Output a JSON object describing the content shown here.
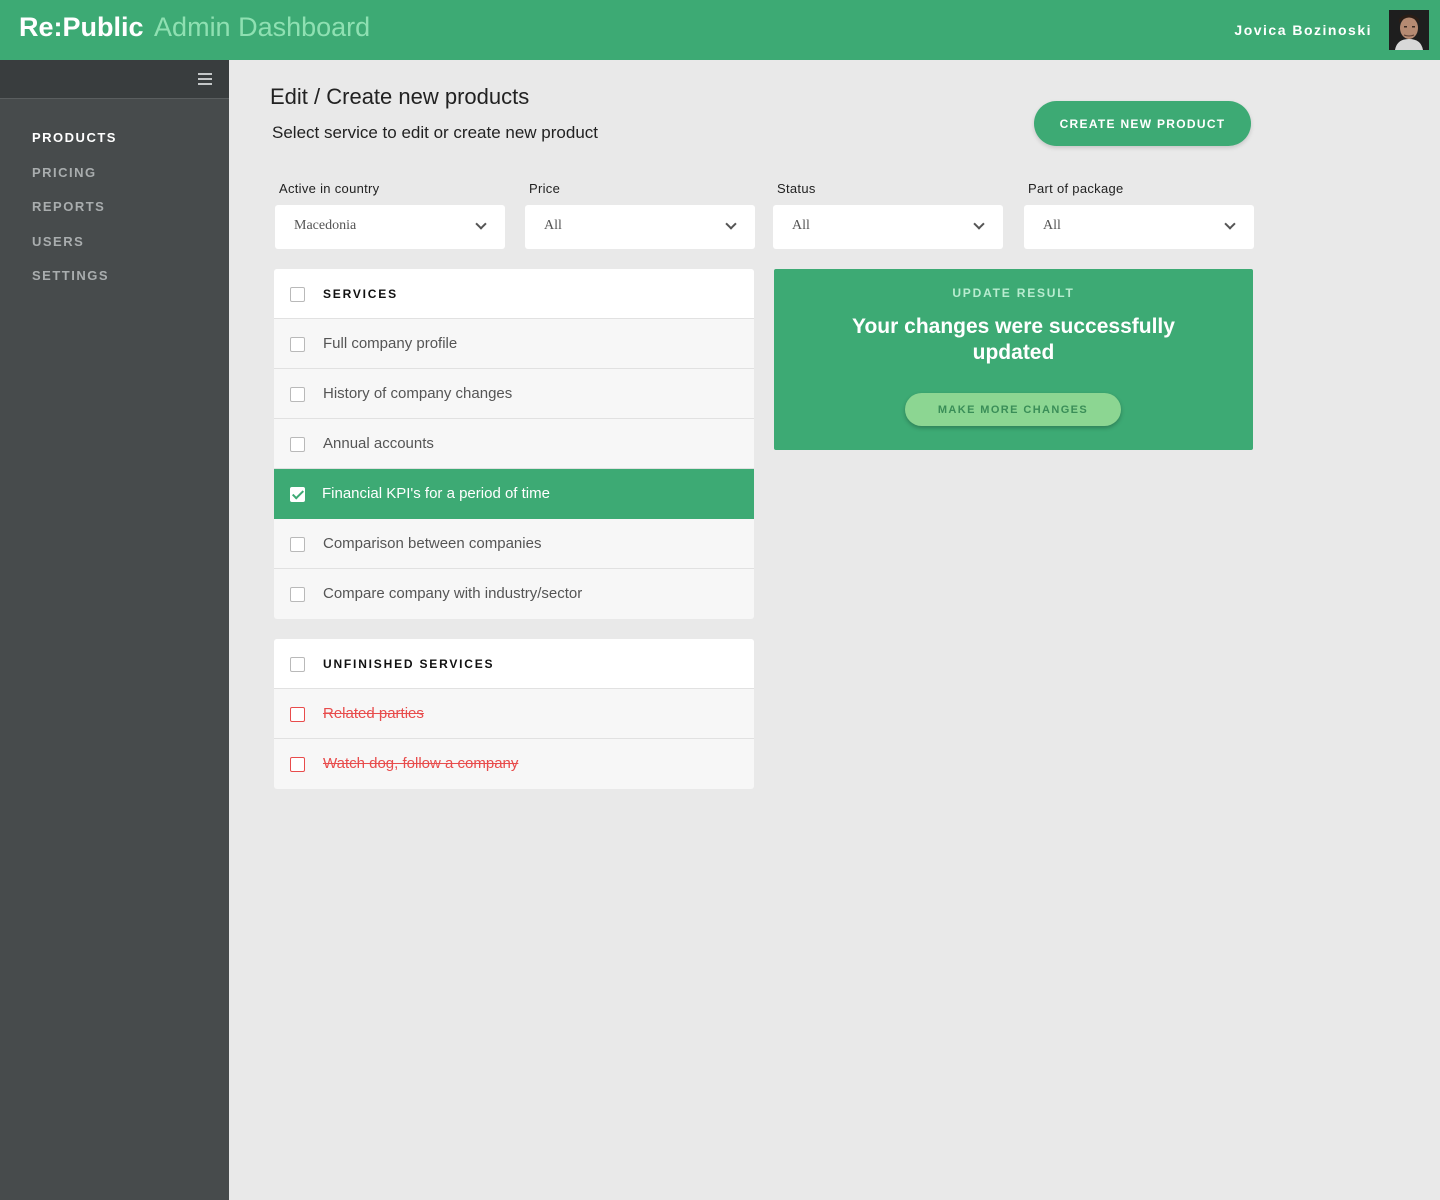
{
  "header": {
    "brand_main": "Re:Public",
    "brand_sub": "Admin Dashboard",
    "user_name": "Jovica Bozinoski",
    "accent_color": "#3daa74"
  },
  "sidebar": {
    "menu_icon": "hamburger-menu-icon",
    "items": [
      {
        "label": "PRODUCTS",
        "active": true
      },
      {
        "label": "PRICING",
        "active": false
      },
      {
        "label": "REPORTS",
        "active": false
      },
      {
        "label": "USERS",
        "active": false
      },
      {
        "label": "SETTINGS",
        "active": false
      }
    ]
  },
  "main": {
    "title": "Edit / Create new products",
    "subtitle": "Select service to edit or create new product",
    "create_button": "CREATE NEW PRODUCT",
    "filters": [
      {
        "label": "Active in country",
        "value": "Macedonia"
      },
      {
        "label": "Price",
        "value": "All"
      },
      {
        "label": "Status",
        "value": "All"
      },
      {
        "label": "Part of package",
        "value": "All"
      }
    ],
    "services": {
      "header": "SERVICES",
      "items": [
        {
          "label": "Full company profile",
          "checked": false
        },
        {
          "label": "History of company changes",
          "checked": false
        },
        {
          "label": "Annual accounts",
          "checked": false
        },
        {
          "label": "Financial KPI's for a period of time",
          "checked": true
        },
        {
          "label": "Comparison between companies",
          "checked": false
        },
        {
          "label": "Compare company with industry/sector",
          "checked": false
        }
      ]
    },
    "unfinished": {
      "header": "UNFINISHED SERVICES",
      "items": [
        {
          "label": "Related parties"
        },
        {
          "label": "Watch dog, follow a company"
        }
      ]
    },
    "result": {
      "label": "UPDATE RESULT",
      "message": "Your changes were successfully updated",
      "button": "MAKE MORE CHANGES"
    }
  }
}
